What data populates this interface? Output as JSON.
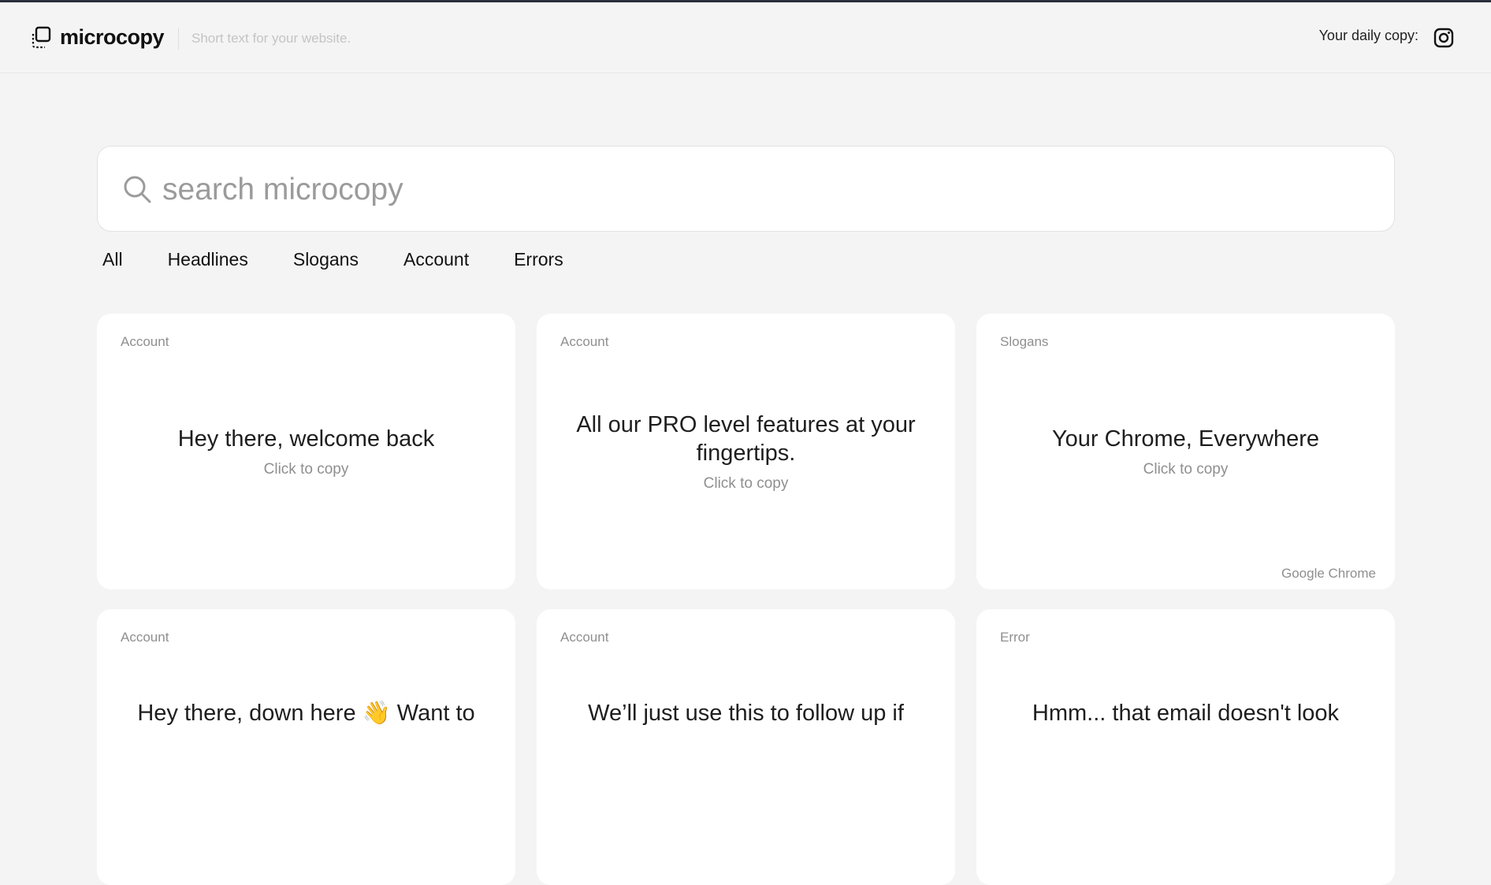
{
  "header": {
    "brand_name": "microcopy",
    "tagline": "Short text for your website.",
    "daily_copy_label": "Your daily copy:"
  },
  "search": {
    "placeholder": "search microcopy",
    "value": ""
  },
  "tabs": [
    {
      "label": "All"
    },
    {
      "label": "Headlines"
    },
    {
      "label": "Slogans"
    },
    {
      "label": "Account"
    },
    {
      "label": "Errors"
    }
  ],
  "cards": [
    {
      "category": "Account",
      "text": "Hey there, welcome back",
      "action": "Click to copy",
      "source": ""
    },
    {
      "category": "Account",
      "text": "All our PRO level features at your fingertips.",
      "action": "Click to copy",
      "source": ""
    },
    {
      "category": "Slogans",
      "text": "Your Chrome, Everywhere",
      "action": "Click to copy",
      "source": "Google Chrome"
    },
    {
      "category": "Account",
      "text": "Hey there, down here 👋 Want to",
      "action": "",
      "source": ""
    },
    {
      "category": "Account",
      "text": "We’ll just use this to follow up if",
      "action": "",
      "source": ""
    },
    {
      "category": "Error",
      "text": "Hmm... that email doesn't look",
      "action": "",
      "source": ""
    }
  ],
  "icons": {
    "brand": "copy-squares-icon",
    "search": "search-icon",
    "social": "instagram-icon"
  },
  "colors": {
    "background": "#f4f4f4",
    "card": "#ffffff",
    "muted_text": "#8f8f8f",
    "top_border": "#2a2f3a"
  }
}
